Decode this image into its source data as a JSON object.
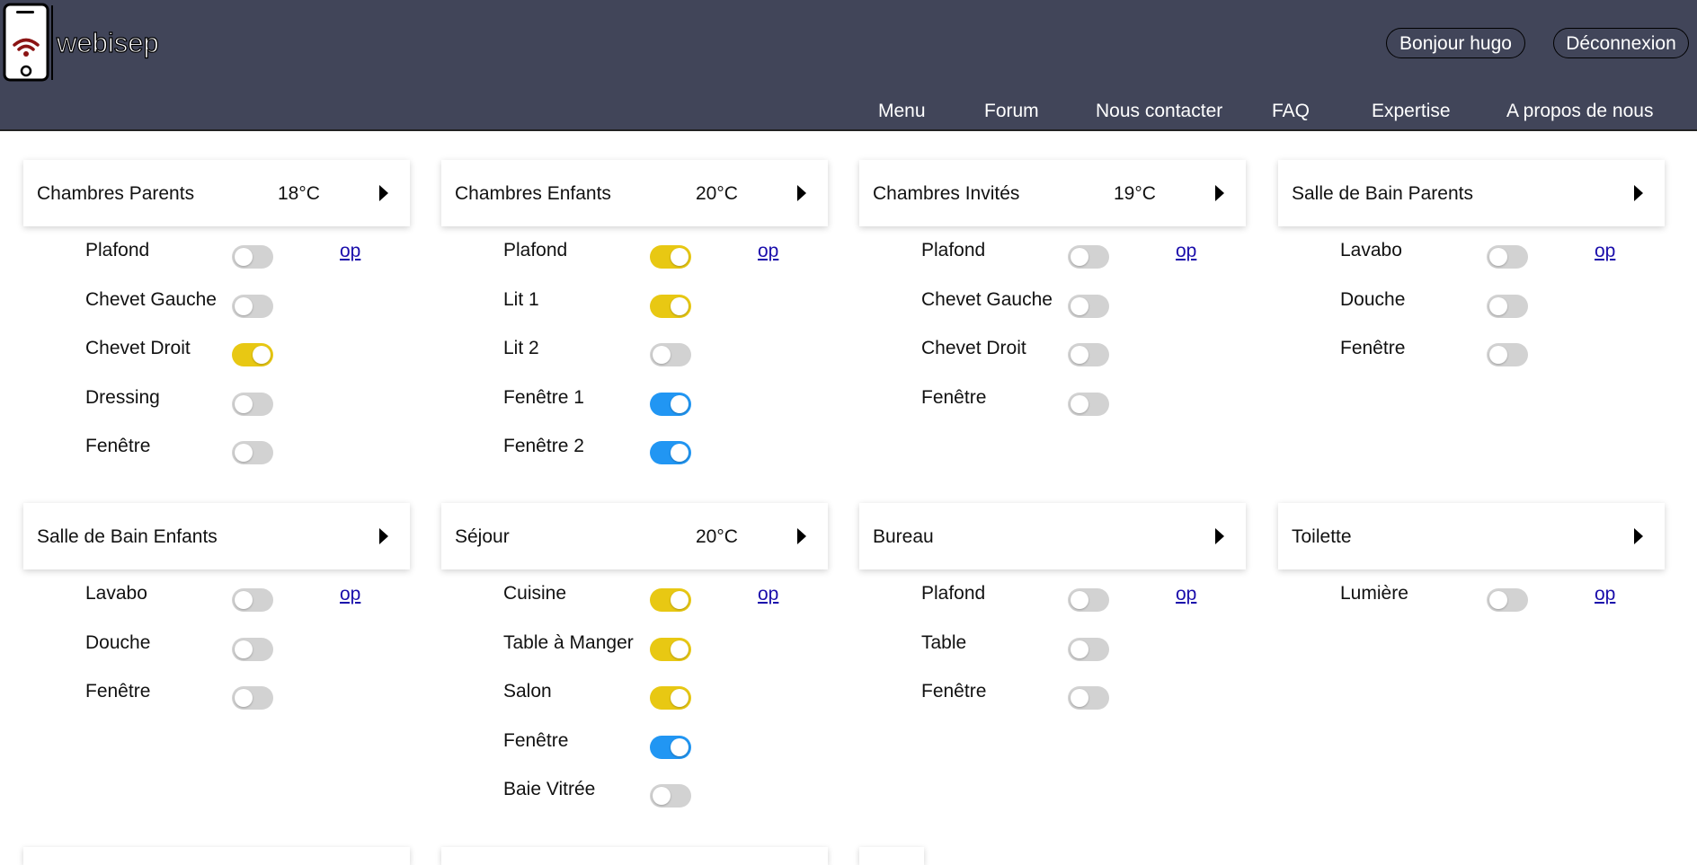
{
  "header": {
    "logo_text": "webisep",
    "greeting": "Bonjour hugo",
    "logout_label": "Déconnexion",
    "nav": [
      "Menu",
      "Forum",
      "Nous contacter",
      "FAQ",
      "Expertise",
      "A propos de nous"
    ]
  },
  "colors": {
    "header_bg": "#414559",
    "toggle_off": "#d2d2d2",
    "toggle_yellow": "#e8c813",
    "toggle_blue": "#2196f3",
    "link": "#1a0dab"
  },
  "rooms": [
    {
      "name": "Chambres Parents",
      "temp": "18°C",
      "link": "op",
      "devices": [
        {
          "label": "Plafond",
          "state": "off"
        },
        {
          "label": "Chevet Gauche",
          "state": "off"
        },
        {
          "label": "Chevet Droit",
          "state": "on-yellow"
        },
        {
          "label": "Dressing",
          "state": "off"
        },
        {
          "label": "Fenêtre",
          "state": "off"
        }
      ]
    },
    {
      "name": "Chambres Enfants",
      "temp": "20°C",
      "link": "op",
      "devices": [
        {
          "label": "Plafond",
          "state": "on-yellow"
        },
        {
          "label": "Lit 1",
          "state": "on-yellow"
        },
        {
          "label": "Lit 2",
          "state": "off"
        },
        {
          "label": "Fenêtre 1",
          "state": "on-blue"
        },
        {
          "label": "Fenêtre 2",
          "state": "on-blue"
        }
      ]
    },
    {
      "name": "Chambres Invités",
      "temp": "19°C",
      "link": "op",
      "devices": [
        {
          "label": "Plafond",
          "state": "off"
        },
        {
          "label": "Chevet Gauche",
          "state": "off"
        },
        {
          "label": "Chevet Droit",
          "state": "off"
        },
        {
          "label": "Fenêtre",
          "state": "off"
        }
      ]
    },
    {
      "name": "Salle de Bain Parents",
      "temp": "",
      "link": "op",
      "devices": [
        {
          "label": "Lavabo",
          "state": "off"
        },
        {
          "label": "Douche",
          "state": "off"
        },
        {
          "label": "Fenêtre",
          "state": "off"
        }
      ]
    },
    {
      "name": "Salle de Bain Enfants",
      "temp": "",
      "link": "op",
      "devices": [
        {
          "label": "Lavabo",
          "state": "off"
        },
        {
          "label": "Douche",
          "state": "off"
        },
        {
          "label": "Fenêtre",
          "state": "off"
        }
      ]
    },
    {
      "name": "Séjour",
      "temp": "20°C",
      "link": "op",
      "devices": [
        {
          "label": "Cuisine",
          "state": "on-yellow"
        },
        {
          "label": "Table à Manger",
          "state": "on-yellow"
        },
        {
          "label": "Salon",
          "state": "on-yellow"
        },
        {
          "label": "Fenêtre",
          "state": "on-blue"
        },
        {
          "label": "Baie Vitrée",
          "state": "off"
        }
      ]
    },
    {
      "name": "Bureau",
      "temp": "",
      "link": "op",
      "devices": [
        {
          "label": "Plafond",
          "state": "off"
        },
        {
          "label": "Table",
          "state": "off"
        },
        {
          "label": "Fenêtre",
          "state": "off"
        }
      ]
    },
    {
      "name": "Toilette",
      "temp": "",
      "link": "op",
      "devices": [
        {
          "label": "Lumière",
          "state": "off"
        }
      ]
    }
  ]
}
